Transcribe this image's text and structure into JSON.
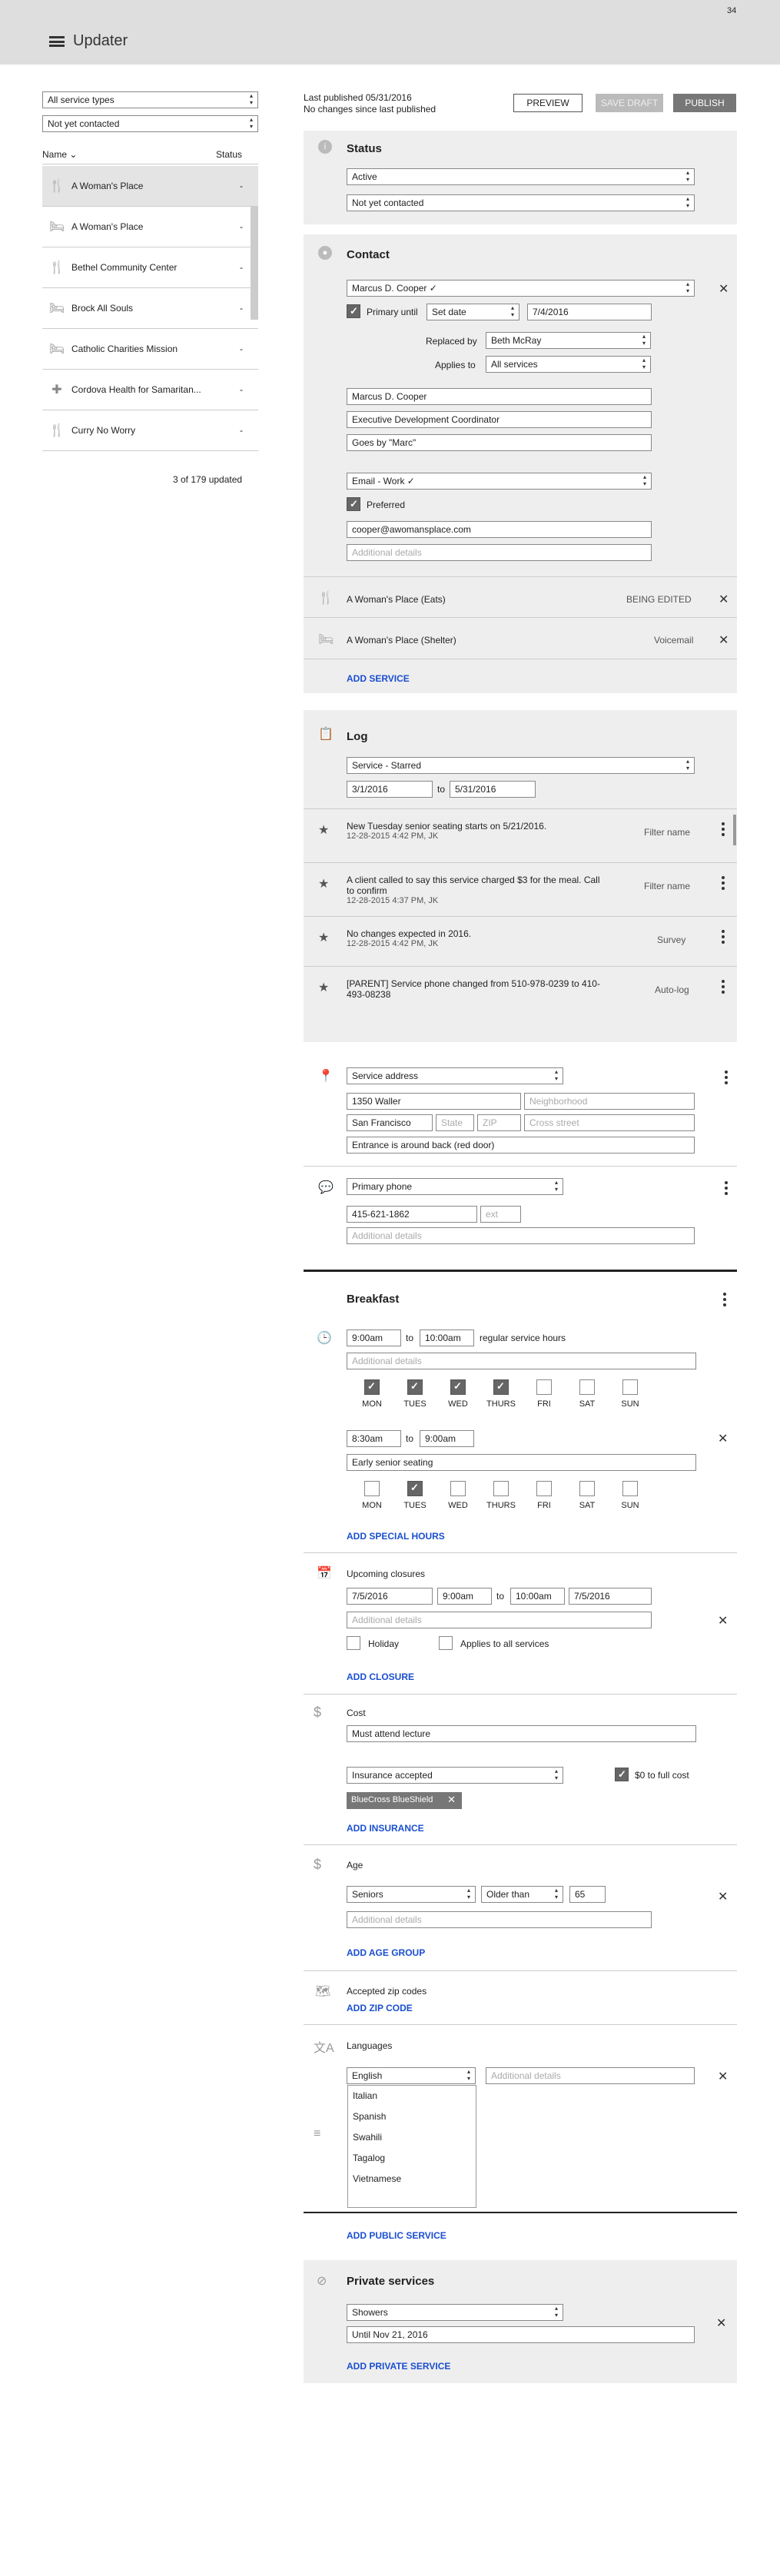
{
  "app": {
    "title": "Updater",
    "page_number": "34"
  },
  "filters": {
    "type": "All service types",
    "contact": "Not yet contacted"
  },
  "list": {
    "col_name": "Name",
    "col_status": "Status",
    "footer": "3 of 179 updated",
    "items": [
      {
        "icon": "utensils-icon",
        "name": "A Woman's Place",
        "status": "-"
      },
      {
        "icon": "bed-icon",
        "name": "A Woman's Place",
        "status": "-"
      },
      {
        "icon": "utensils-icon",
        "name": "Bethel Community Center",
        "status": "-"
      },
      {
        "icon": "bed-icon",
        "name": "Brock All Souls",
        "status": "-"
      },
      {
        "icon": "bed-icon",
        "name": "Catholic Charities Mission",
        "status": "-"
      },
      {
        "icon": "medical-icon",
        "name": "Cordova Health for Samaritan...",
        "status": "-"
      },
      {
        "icon": "utensils-icon",
        "name": "Curry No Worry",
        "status": "-"
      }
    ]
  },
  "header": {
    "published": "Last published 05/31/2016",
    "changes": "No changes since last published",
    "preview": "PREVIEW",
    "save_draft": "SAVE DRAFT",
    "publish": "PUBLISH"
  },
  "status": {
    "title": "Status",
    "state": "Active",
    "contact": "Not yet contacted"
  },
  "contact": {
    "title": "Contact",
    "person": "Marcus D. Cooper ✓",
    "primary_label": "Primary until",
    "set_date": "Set date",
    "date": "7/4/2016",
    "replaced_label": "Replaced by",
    "replaced": "Beth McRay",
    "applies_label": "Applies to",
    "applies": "All services",
    "name": "Marcus D. Cooper",
    "role": "Executive Development Coordinator",
    "goes_by": "Goes by \"Marc\"",
    "email_type": "Email - Work ✓",
    "preferred": "Preferred",
    "email": "cooper@awomansplace.com",
    "details_ph": "Additional details"
  },
  "services": [
    {
      "name": "A Woman's Place (Eats)",
      "status": "BEING EDITED"
    },
    {
      "name": "A Woman's Place (Shelter)",
      "status": "Voicemail"
    }
  ],
  "add_service": "ADD SERVICE",
  "log": {
    "title": "Log",
    "filter": "Service - Starred",
    "from": "3/1/2016",
    "to_label": "to",
    "to": "5/31/2016",
    "entries": [
      {
        "text": "New Tuesday senior seating starts on 5/21/2016.",
        "meta": "12-28-2015 4:42 PM, JK",
        "source": "Filter name"
      },
      {
        "text": "A client called to say this service charged $3 for the meal. Call to confirm",
        "meta": "12-28-2015 4:37 PM, JK",
        "source": "Filter name"
      },
      {
        "text": "No changes expected in 2016.",
        "meta": "12-28-2015 4:42 PM, JK",
        "source": "Survey"
      },
      {
        "text": "[PARENT] Service phone changed from 510-978-0239 to 410-493-08238",
        "meta": "",
        "source": "Auto-log"
      }
    ]
  },
  "address": {
    "type": "Service address",
    "street": "1350 Waller",
    "neighborhood_ph": "Neighborhood",
    "city": "San Francisco",
    "state_ph": "State",
    "zip_ph": "ZIP",
    "cross_ph": "Cross street",
    "note": "Entrance is around back (red door)"
  },
  "phone": {
    "type": "Primary phone",
    "number": "415-621-1862",
    "ext_ph": "ext",
    "details_ph": "Additional details"
  },
  "breakfast": {
    "title": "Breakfast",
    "from1": "9:00am",
    "to_label": "to",
    "to1": "10:00am",
    "regular": "regular service hours",
    "details_ph": "Additional details",
    "days": [
      "MON",
      "TUES",
      "WED",
      "THURS",
      "FRI",
      "SAT",
      "SUN"
    ],
    "days1": [
      true,
      true,
      true,
      true,
      false,
      false,
      false
    ],
    "from2": "8:30am",
    "to2": "9:00am",
    "special_label": "Early senior seating",
    "days2": [
      false,
      true,
      false,
      false,
      false,
      false,
      false
    ],
    "add_special": "ADD SPECIAL HOURS"
  },
  "closures": {
    "title": "Upcoming closures",
    "d1": "7/5/2016",
    "t1": "9:00am",
    "to_label": "to",
    "t2": "10:00am",
    "d2": "7/5/2016",
    "details_ph": "Additional details",
    "holiday": "Holiday",
    "applies_all": "Applies to all services",
    "add": "ADD CLOSURE"
  },
  "cost": {
    "title": "Cost",
    "note": "Must attend lecture",
    "insurance": "Insurance accepted",
    "full_cost": "$0 to full cost",
    "chip": "BlueCross BlueShield",
    "add": "ADD INSURANCE"
  },
  "age": {
    "title": "Age",
    "group": "Seniors",
    "cmp": "Older than",
    "value": "65",
    "details_ph": "Additional details",
    "add": "ADD AGE GROUP"
  },
  "zip": {
    "title": "Accepted zip codes",
    "add": "ADD ZIP CODE"
  },
  "languages": {
    "title": "Languages",
    "selected": "English",
    "details_ph": "Additional details",
    "options": [
      "Italian",
      "Spanish",
      "Swahili",
      "Tagalog",
      "Vietnamese"
    ]
  },
  "add_public": "ADD PUBLIC SERVICE",
  "private": {
    "title": "Private services",
    "service": "Showers",
    "until": "Until Nov 21, 2016",
    "add": "ADD PRIVATE SERVICE"
  }
}
